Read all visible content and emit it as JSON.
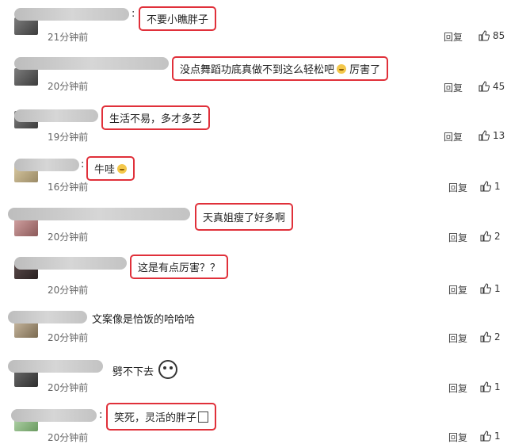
{
  "comments": [
    {
      "text": "不要小瞧胖子",
      "time": "21分钟前",
      "reply": "回复",
      "likes": "85",
      "boxed": true,
      "emoji": ""
    },
    {
      "text": "没点舞蹈功底真做不到这么轻松吧",
      "time": "20分钟前",
      "reply": "回复",
      "likes": "45",
      "boxed": true,
      "emoji": "laughing-emoji",
      "suffix": " 厉害了"
    },
    {
      "text": "生活不易，多才多艺",
      "time": "19分钟前",
      "reply": "回复",
      "likes": "13",
      "boxed": true,
      "emoji": ""
    },
    {
      "text": "牛哇",
      "time": "16分钟前",
      "reply": "回复",
      "likes": "1",
      "boxed": true,
      "emoji": "smile-emoji"
    },
    {
      "text": "天真姐瘦了好多啊",
      "time": "20分钟前",
      "reply": "回复",
      "likes": "2",
      "boxed": true,
      "emoji": ""
    },
    {
      "text": "这是有点厉害？？",
      "time": "20分钟前",
      "reply": "回复",
      "likes": "1",
      "boxed": true,
      "emoji": ""
    },
    {
      "text": "文案像是恰饭的哈哈哈",
      "time": "20分钟前",
      "reply": "回复",
      "likes": "2",
      "boxed": false,
      "emoji": ""
    },
    {
      "text": "劈不下去",
      "time": "20分钟前",
      "reply": "回复",
      "likes": "1",
      "boxed": false,
      "emoji": "sticker-emoji"
    },
    {
      "text": "笑死，灵活的胖子",
      "time": "20分钟前",
      "reply": "回复",
      "likes": "1",
      "boxed": true,
      "emoji": "box-glyph"
    }
  ],
  "colors": {
    "highlight_border": "#e0303a",
    "meta_text": "#666666",
    "background": "#ffffff"
  },
  "icons": {
    "like": "thumbs-up-icon",
    "avatar": "avatar-image"
  }
}
